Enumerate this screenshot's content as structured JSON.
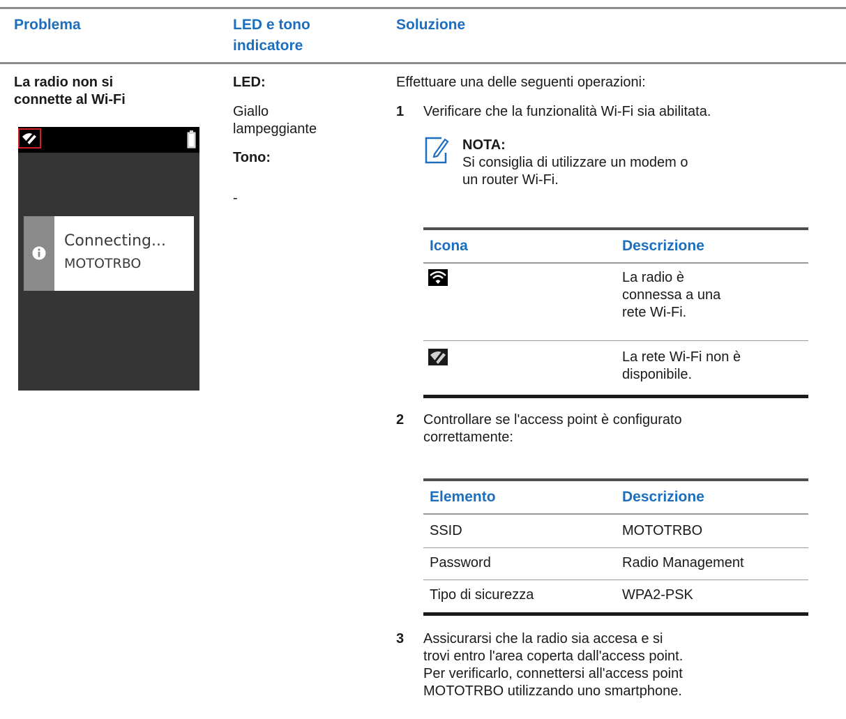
{
  "headers": {
    "problem": "Problema",
    "led_line1": "LED e tono",
    "led_line2": "indicatore",
    "solution": "Soluzione"
  },
  "problem": {
    "line1": "La radio non si",
    "line2": "connette al Wi-Fi",
    "screen": {
      "line1": "Connecting...",
      "line2": "MOTOTRBO"
    }
  },
  "led": {
    "label": "LED:",
    "value_line1": "Giallo",
    "value_line2": "lampeggiante",
    "tone_label": "Tono:",
    "tone_value": "-"
  },
  "solution": {
    "intro": "Effettuare una delle seguenti operazioni:",
    "step1": {
      "num": "1",
      "text": "Verificare che la funzionalità Wi-Fi sia abilitata.",
      "note_label": "NOTA:",
      "note_line1": "Si consiglia di utilizzare un modem o",
      "note_line2": "un router Wi-Fi."
    },
    "icon_table": {
      "header_icon": "Icona",
      "header_desc": "Descrizione",
      "row1": {
        "icon": "wifi-connected-icon",
        "line1": "La radio è",
        "line2": "connessa a una",
        "line3": "rete Wi-Fi."
      },
      "row2": {
        "icon": "wifi-unavailable-icon",
        "line1": "La rete Wi-Fi non è",
        "line2": "disponibile."
      }
    },
    "step2": {
      "num": "2",
      "line1": "Controllare se l'access point è configurato",
      "line2": "correttamente:"
    },
    "config_table": {
      "header_item": "Elemento",
      "header_desc": "Descrizione",
      "rows": [
        {
          "item": "SSID",
          "desc": "MOTOTRBO"
        },
        {
          "item": "Password",
          "desc": "Radio Management"
        },
        {
          "item": "Tipo di sicurezza",
          "desc": "WPA2-PSK"
        }
      ]
    },
    "step3": {
      "num": "3",
      "line1": "Assicurarsi che la radio sia accesa e si",
      "line2": "trovi entro l'area coperta dall'access point.",
      "line3": "Per verificarlo, connettersi all'access point",
      "line4": "MOTOTRBO utilizzando uno smartphone."
    }
  },
  "colors": {
    "header_blue": "#1c6ebf",
    "highlight_red": "#d21f26"
  }
}
